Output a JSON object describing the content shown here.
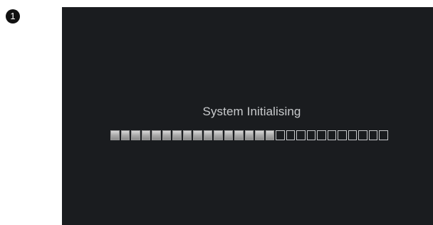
{
  "step_number": "1",
  "screen": {
    "status_text": "System Initialising",
    "progress": {
      "filled_segments": 16,
      "total_segments": 27,
      "fraction": 0.593
    }
  },
  "colors": {
    "screen_background": "#1a1c1f",
    "text": "#c9cbcd",
    "segment_filled": "#b0b0b0",
    "segment_empty_border": "#c6c8ca"
  }
}
